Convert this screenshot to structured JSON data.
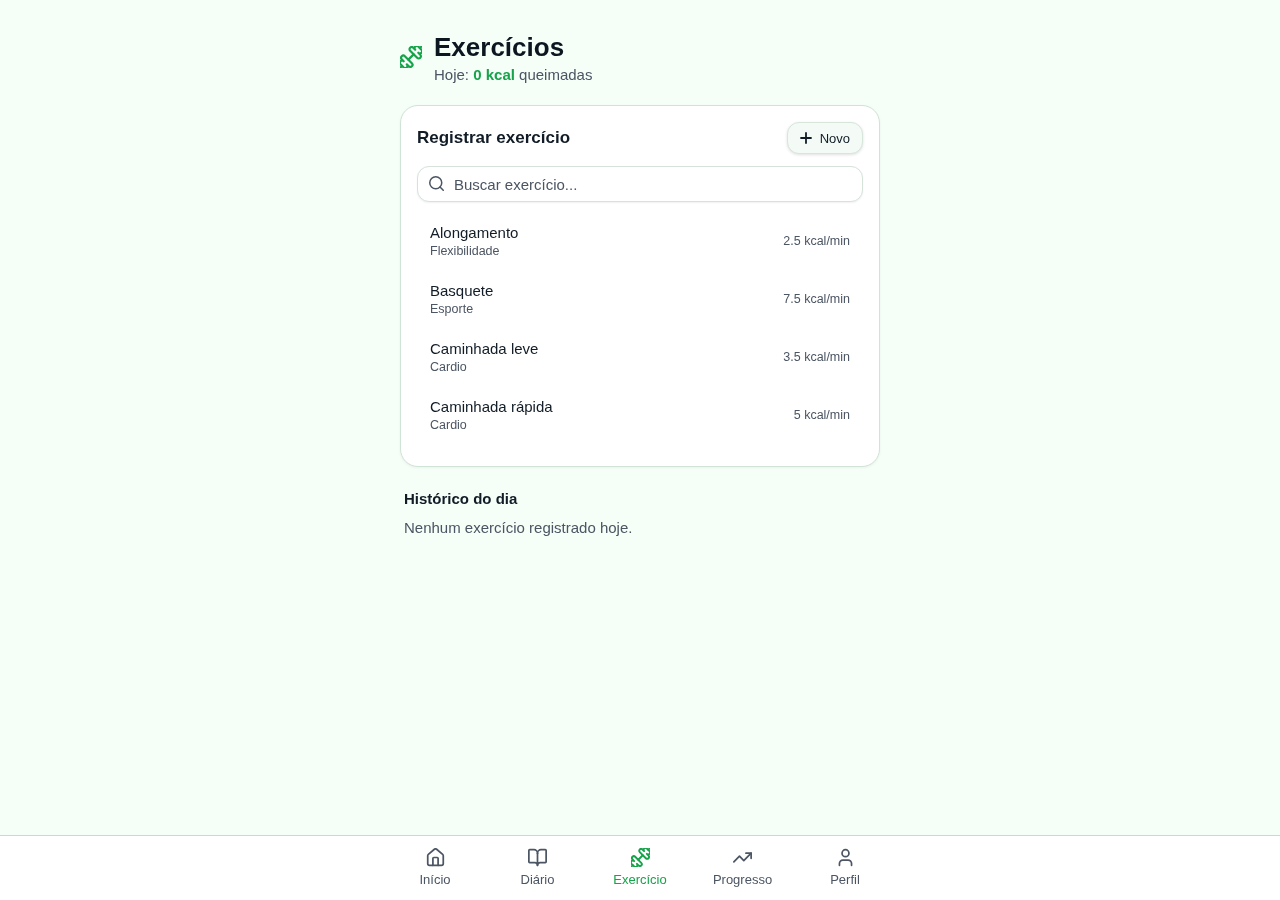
{
  "header": {
    "title": "Exercícios",
    "subtitle": "Hoje: **0 kcal** queimadas"
  },
  "register_card": {
    "title": "Registrar exercício",
    "new_button": "Novo",
    "search": {
      "placeholder": "Buscar exercício..."
    },
    "exercises": [
      {
        "name": "Alongamento",
        "category": "Flexibilidade",
        "rate": "2.5 kcal/min"
      },
      {
        "name": "Basquete",
        "category": "Esporte",
        "rate": "7.5 kcal/min"
      },
      {
        "name": "Caminhada leve",
        "category": "Cardio",
        "rate": "3.5 kcal/min"
      },
      {
        "name": "Caminhada rápida",
        "category": "Cardio",
        "rate": "5 kcal/min"
      }
    ]
  },
  "history": {
    "title": "Histórico do dia",
    "empty_text": "Nenhum exercício registrado hoje."
  },
  "bottom_nav": [
    {
      "kind": "home",
      "label": "Início",
      "selected": false
    },
    {
      "kind": "diary",
      "label": "Diário",
      "selected": false
    },
    {
      "kind": "exercise",
      "label": "Exercício",
      "selected": true
    },
    {
      "kind": "progress",
      "label": "Progresso",
      "selected": false
    },
    {
      "kind": "profile",
      "label": "Perfil",
      "selected": false
    }
  ]
}
